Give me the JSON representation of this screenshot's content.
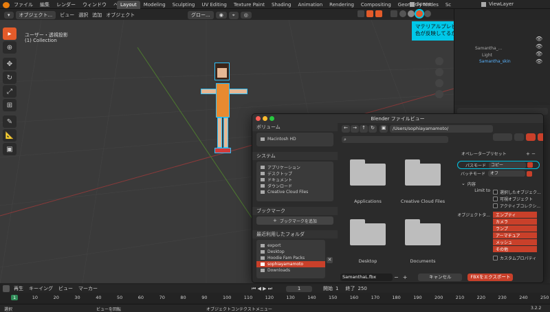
{
  "topbar": {
    "menu": [
      "ファイル",
      "編集",
      "レンダー",
      "ウィンドウ",
      "ヘルプ"
    ],
    "tabs": [
      "Layout",
      "Modeling",
      "Sculpting",
      "UV Editing",
      "Texture Paint",
      "Shading",
      "Animation",
      "Rendering",
      "Compositing",
      "Geometry Nodes",
      "Sc"
    ],
    "active_tab": "Layout",
    "scene": "Scene",
    "view_layer": "ViewLayer"
  },
  "viewport_header": {
    "mode": "オブジェクト...",
    "menus": [
      "ビュー",
      "選択",
      "追加",
      "オブジェクト"
    ],
    "orientation": "グロー..."
  },
  "viewport": {
    "view_name": "ユーザー・透視投影",
    "collection": "(1) Collection"
  },
  "callout": {
    "text_line1": "マテリアルプレビューモードで",
    "text_line2": "色が反映してるか確認する。"
  },
  "outliner": {
    "items": [
      "Samantha_...",
      "Light",
      "Samantha_skin"
    ]
  },
  "file_browser": {
    "title": "Blender ファイルビュー",
    "path": "/Users/sophiayamamoto/",
    "sections": {
      "volumes": {
        "label": "ボリューム",
        "items": [
          "Macintosh HD"
        ]
      },
      "system": {
        "label": "システム",
        "items": [
          "アプリケーション",
          "デスクトップ",
          "ドキュメント",
          "ダウンロード",
          "Creative Cloud Files"
        ]
      },
      "bookmarks": {
        "label": "ブックマーク",
        "add_label": "ブックマークを追加"
      },
      "recent": {
        "label": "最近利用したフォルダ",
        "items": [
          "export",
          "Desktop",
          "Hoodie Fam Packs",
          "sophiayamamoto",
          "Downloads"
        ],
        "selected": "sophiayamamoto"
      }
    },
    "folders": [
      "Applications",
      "Creative Cloud Files",
      "Desktop",
      "Documents"
    ],
    "filename": "SamanthaL.fbx",
    "cancel_label": "キャンセル",
    "export_label": "FBXをエクスポート",
    "operator_presets": "オペレータープリセット",
    "path_mode_label": "パスモード",
    "path_mode_value": "コピー",
    "batch_mode_label": "バッチモード",
    "batch_mode_value": "オフ",
    "include_label": "内容",
    "limit_to_label": "Limit to",
    "limit_options": [
      "選択したオブジェク...",
      "可視オブジェクト",
      "アクティブコレクシ..."
    ],
    "object_types_label": "オブジェクトタ...",
    "object_types": [
      "エンプティ",
      "カメラ",
      "ランプ",
      "アーマチュア",
      "メッシュ",
      "その他"
    ],
    "custom_props": "カスタムプロパティ"
  },
  "timeline": {
    "menus": [
      "再生",
      "キーイング",
      "ビュー",
      "マーカー"
    ],
    "current_frame": "1",
    "start_label": "開始",
    "start_value": "1",
    "end_label": "終了",
    "end_value": "250",
    "ticks": [
      "1",
      "10",
      "20",
      "30",
      "40",
      "50",
      "60",
      "70",
      "80",
      "90",
      "100",
      "110",
      "120",
      "130",
      "140",
      "150",
      "160",
      "170",
      "180",
      "190",
      "200",
      "210",
      "220",
      "230",
      "240",
      "250"
    ]
  },
  "statusbar": {
    "select": "選択",
    "rotate": "ビューを回転",
    "context": "オブジェクトコンテクストメニュー",
    "version": "3.2.2"
  },
  "colors": {
    "accent": "#e35b2a",
    "callout_bg": "#00c8e8",
    "selected_row": "#c9402a"
  }
}
